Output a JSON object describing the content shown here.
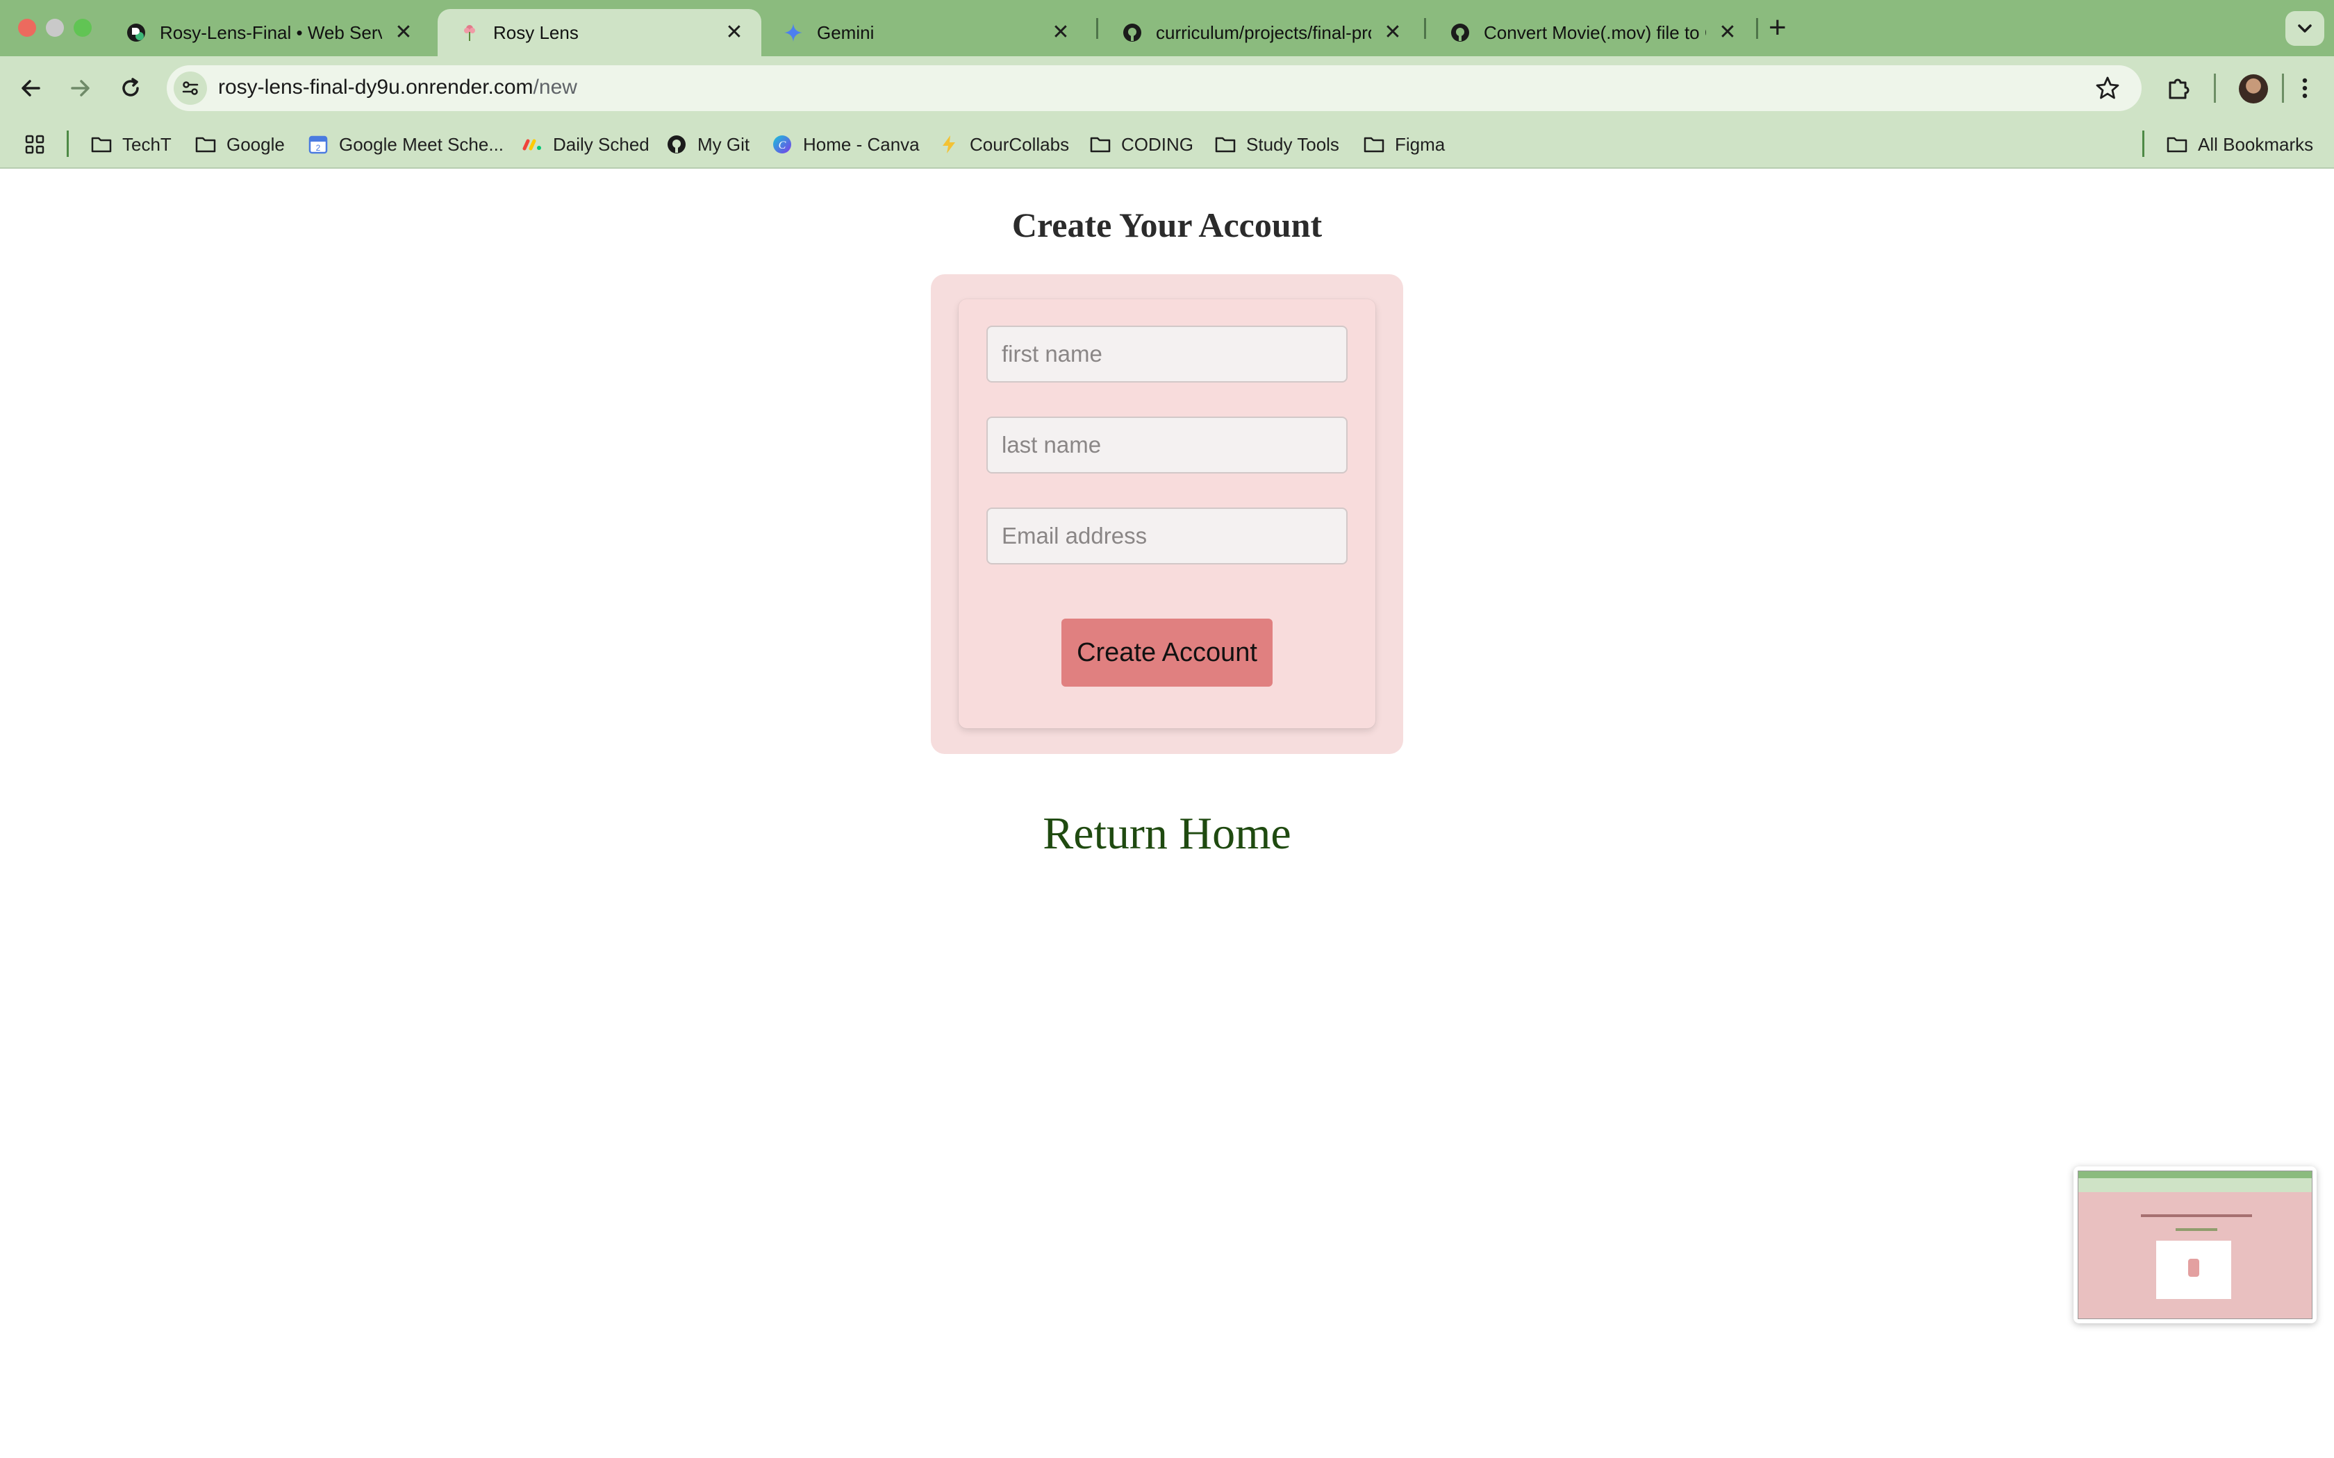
{
  "browser": {
    "tabs": [
      {
        "title": "Rosy-Lens-Final • Web Serv",
        "favicon": "render-icon",
        "active": false
      },
      {
        "title": "Rosy Lens",
        "favicon": "flower-icon",
        "active": true
      },
      {
        "title": "Gemini",
        "favicon": "gemini-sparkle-icon",
        "active": false
      },
      {
        "title": "curriculum/projects/final-proj",
        "favicon": "github-icon",
        "active": false
      },
      {
        "title": "Convert Movie(.mov) file to G",
        "favicon": "github-icon",
        "active": false
      }
    ],
    "close_glyph": "✕",
    "new_tab_glyph": "+",
    "url_host": "rosy-lens-final-dy9u.onrender.com",
    "url_path": "/new",
    "bookmarks": [
      {
        "label": "TechT",
        "icon": "folder-icon"
      },
      {
        "label": "Google",
        "icon": "folder-icon"
      },
      {
        "label": "Google Meet Sche...",
        "icon": "calendar-icon"
      },
      {
        "label": "Daily Sched",
        "icon": "monday-icon"
      },
      {
        "label": "My Git",
        "icon": "github-icon"
      },
      {
        "label": "Home - Canva",
        "icon": "canva-icon"
      },
      {
        "label": "CourCollabs",
        "icon": "bolt-icon"
      },
      {
        "label": "CODING",
        "icon": "folder-icon"
      },
      {
        "label": "Study Tools",
        "icon": "folder-icon"
      },
      {
        "label": "Figma",
        "icon": "folder-icon"
      }
    ],
    "all_bookmarks_label": "All Bookmarks"
  },
  "page": {
    "title": "Create Your Account",
    "form": {
      "first_name_placeholder": "first name",
      "last_name_placeholder": "last name",
      "email_placeholder": "Email address",
      "first_name_value": "",
      "last_name_value": "",
      "email_value": "",
      "submit_label": "Create Account"
    },
    "return_home_label": "Return Home"
  },
  "colors": {
    "tab_strip": "#8bbb7e",
    "toolbar": "#cfe3c6",
    "card_background": "#f6dddd",
    "button": "#e08080",
    "return_link": "#1f4a10"
  }
}
